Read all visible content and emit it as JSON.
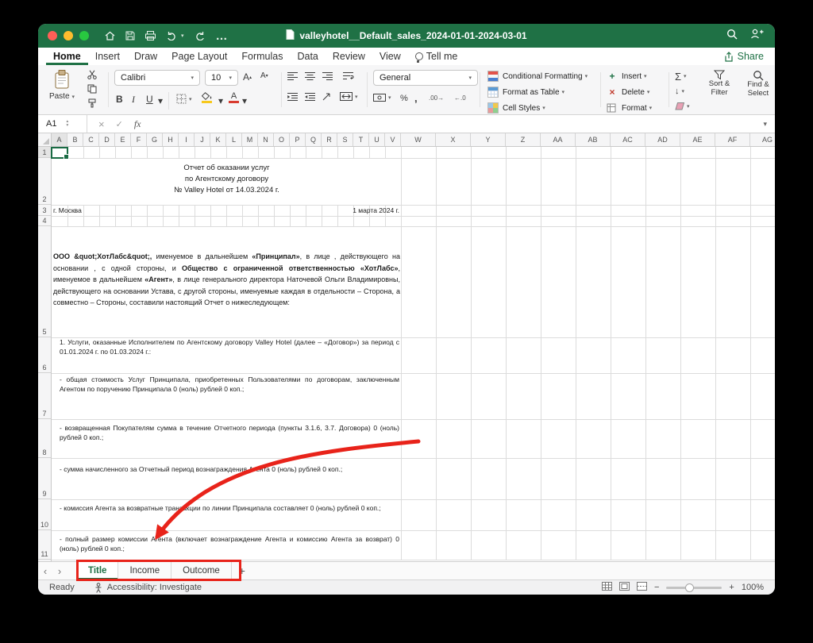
{
  "colors": {
    "accent": "#1f7145",
    "annotation_red": "#e8231a"
  },
  "window": {
    "title": "valleyhotel__Default_sales_2024-01-01-2024-03-01"
  },
  "ribbon_tabs": [
    {
      "label": "Home",
      "active": true
    },
    {
      "label": "Insert",
      "active": false
    },
    {
      "label": "Draw",
      "active": false
    },
    {
      "label": "Page Layout",
      "active": false
    },
    {
      "label": "Formulas",
      "active": false
    },
    {
      "label": "Data",
      "active": false
    },
    {
      "label": "Review",
      "active": false
    },
    {
      "label": "View",
      "active": false
    },
    {
      "label": "Tell me",
      "active": false,
      "icon": "lightbulb"
    }
  ],
  "share_label": "Share",
  "ribbon": {
    "paste_label": "Paste",
    "font_name": "Calibri",
    "font_size": "10",
    "number_format": "General",
    "styles": [
      "Conditional Formatting",
      "Format as Table",
      "Cell Styles"
    ],
    "cells": [
      "Insert",
      "Delete",
      "Format"
    ],
    "editing": [
      "Sort & Filter",
      "Find & Select"
    ]
  },
  "formula_bar": {
    "name_box": "A1",
    "fx_label": "fx"
  },
  "icons": {
    "chevron": "▾",
    "bold": "B",
    "italic": "I",
    "underline": "U",
    "letter_a": "A",
    "sigma": "Σ",
    "fill_down": "↓",
    "percent": "%",
    "comma": ",",
    "decrease_decimal": "←.0",
    "increase_decimal": ".00→",
    "ellipsis": "…",
    "up": "▴",
    "down": "▾",
    "cancel": "×",
    "enter": "✓",
    "prev": "‹",
    "next": "›",
    "minus": "−",
    "plus": "+"
  },
  "sheet": {
    "columns": [
      "A",
      "B",
      "C",
      "D",
      "E",
      "F",
      "G",
      "H",
      "I",
      "J",
      "K",
      "L",
      "M",
      "N",
      "O",
      "P",
      "Q",
      "R",
      "S",
      "T",
      "U",
      "V",
      "W",
      "X",
      "Y",
      "Z",
      "AA",
      "AB",
      "AC",
      "AD",
      "AE",
      "AF",
      "AG"
    ],
    "rows": [
      "1",
      "2",
      "3",
      "4",
      "5",
      "6",
      "7",
      "8",
      "9",
      "10",
      "11"
    ],
    "cells": {
      "title_lines": [
        "Отчет об оказании услуг",
        "по Агентскому договору",
        "№ Valley Hotel от 14.03.2024 г."
      ],
      "city": "г. Москва",
      "date": "1 марта 2024 г.",
      "paragraph": [
        {
          "t": "ООО &quot;ХотЛабс&quot;,",
          "b": true
        },
        {
          "t": " именуемое в дальнейшем ",
          "b": false
        },
        {
          "t": "«Принципал»",
          "b": true
        },
        {
          "t": ", в лице , действующего на основании , с одной стороны, и ",
          "b": false
        },
        {
          "t": "Общество с ограниченной ответственностью «ХотЛабс»",
          "b": true
        },
        {
          "t": ", именуемое в дальнейшем ",
          "b": false
        },
        {
          "t": "«Агент»",
          "b": true
        },
        {
          "t": ", в лице генерального директора Наточевой Ольги Владимировны, действующего на основании Устава, с другой стороны, именуемые каждая в отдельности – Сторона, а совместно – Стороны, составили настоящий Отчет о нижеследующем:",
          "b": false
        }
      ],
      "items": [
        "1. Услуги, оказанные Исполнителем по Агентскому договору Valley Hotel (далее – «Договор») за период с 01.01.2024 г. по 01.03.2024 г.:",
        "- общая стоимость Услуг Принципала, приобретенных Пользователями по договорам, заключенным Агентом по поручению Принципала 0 (ноль) рублей 0 коп.;",
        "- возвращенная Покупателям сумма в течение Отчетного периода (пункты 3.1.6, 3.7. Договора) 0 (ноль) рублей 0 коп.;",
        "- сумма начисленного за Отчетный период вознаграждения Агента 0 (ноль) рублей 0 коп.;",
        "- комиссия Агента за возвратные транзакции по линии Принципала составляет 0 (ноль) рублей 0 коп.;",
        "- полный размер комиссии Агента (включает вознаграждение Агента и комиссию Агента за возврат) 0 (ноль) рублей 0 коп.;"
      ]
    }
  },
  "sheet_tabs": {
    "tabs": [
      {
        "label": "Title",
        "active": true
      },
      {
        "label": "Income",
        "active": false
      },
      {
        "label": "Outcome",
        "active": false
      }
    ],
    "add_label": "+"
  },
  "status_bar": {
    "ready": "Ready",
    "accessibility": "Accessibility: Investigate",
    "zoom": "100%"
  }
}
